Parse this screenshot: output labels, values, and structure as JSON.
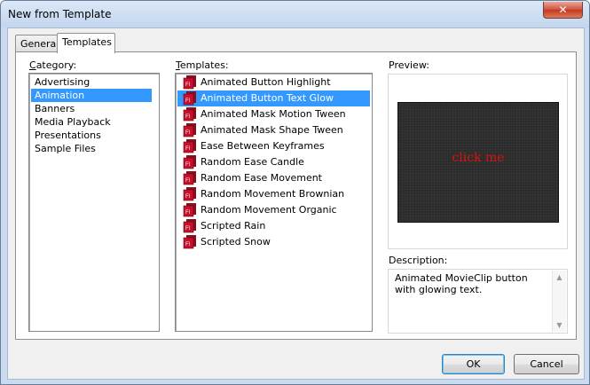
{
  "window": {
    "title": "New from Template",
    "close_glyph": "✕"
  },
  "tabs": [
    {
      "label": "General"
    },
    {
      "label": "Templates"
    }
  ],
  "category": {
    "label_prefix": "",
    "label_underlined": "C",
    "label_rest": "ategory:",
    "items": [
      "Advertising",
      "Animation",
      "Banners",
      "Media Playback",
      "Presentations",
      "Sample Files"
    ],
    "selected": "Animation"
  },
  "templates": {
    "label_underlined": "T",
    "label_rest": "emplates:",
    "icon": "flash-file-icon",
    "items": [
      "Animated Button Highlight",
      "Animated Button Text Glow",
      "Animated Mask Motion Tween",
      "Animated Mask Shape Tween",
      "Ease Between Keyframes",
      "Random Ease Candle",
      "Random Ease Movement",
      "Random Movement Brownian",
      "Random Movement Organic",
      "Scripted Rain",
      "Scripted Snow"
    ],
    "selected": "Animated Button Text Glow"
  },
  "preview": {
    "label": "Preview:",
    "stage_text": "click me",
    "stage_text_color": "#e01010"
  },
  "description": {
    "label": "Description:",
    "text": "Animated MovieClip button with glowing text."
  },
  "buttons": {
    "ok": "OK",
    "cancel": "Cancel"
  },
  "colors": {
    "selection": "#3399ff",
    "icon_red": "#c8102e"
  }
}
